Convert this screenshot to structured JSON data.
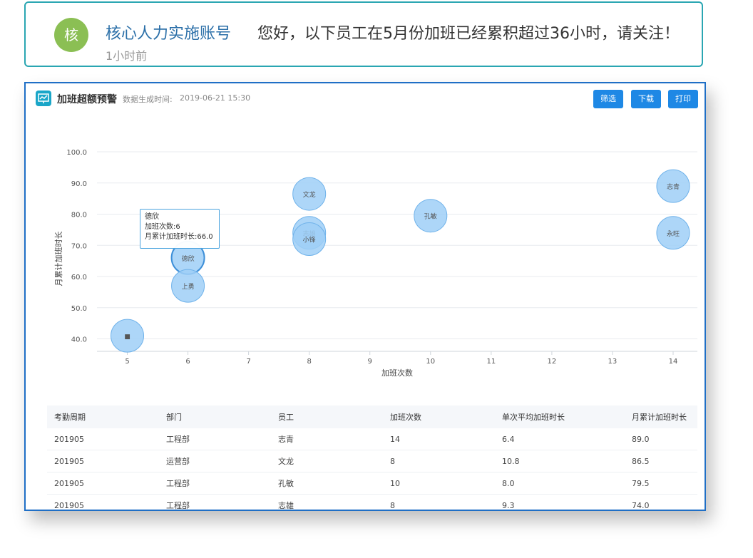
{
  "notification": {
    "avatar_text": "核",
    "sender": "核心人力实施账号",
    "message": "您好，以下员工在5月份加班已经累积超过36小时，请关注！",
    "time": "1小时前"
  },
  "panel": {
    "title": "加班超额预警",
    "meta_label": "数据生成时间:",
    "meta_value": "2019-06-21 15:30",
    "buttons": {
      "filter": "筛选",
      "download": "下载",
      "print": "打印"
    }
  },
  "chart_data": {
    "type": "scatter",
    "xlabel": "加班次数",
    "ylabel": "月累计加班时长",
    "xticks": [
      5,
      6,
      7,
      8,
      9,
      10,
      11,
      12,
      13,
      14
    ],
    "yticks": [
      "40.0",
      "50.0",
      "60.0",
      "70.0",
      "80.0",
      "90.0",
      "100.0"
    ],
    "xlim": [
      4.5,
      14.4
    ],
    "ylim": [
      36,
      100
    ],
    "grid": true,
    "points": [
      {
        "x": 5,
        "y": 41.0,
        "label": "■"
      },
      {
        "x": 6,
        "y": 66.0,
        "label": "德欣"
      },
      {
        "x": 6,
        "y": 57.0,
        "label": "上勇"
      },
      {
        "x": 8,
        "y": 86.5,
        "label": "文龙"
      },
      {
        "x": 8,
        "y": 74.0,
        "label": "志雄"
      },
      {
        "x": 8,
        "y": 72.0,
        "label": "小锋"
      },
      {
        "x": 10,
        "y": 79.5,
        "label": "孔敏"
      },
      {
        "x": 14,
        "y": 89.0,
        "label": "志青"
      },
      {
        "x": 14,
        "y": 74.0,
        "label": "永旺"
      }
    ],
    "tooltip": {
      "name": "德欣",
      "count_line": "加班次数:6",
      "hours_line": "月累计加班时长:66.0"
    },
    "colors": {
      "bubble_fill": "#9fcff7",
      "bubble_stroke": "#6fb2ea",
      "highlight_stroke": "#3d8fd8"
    }
  },
  "table": {
    "headers": [
      "考勤周期",
      "部门",
      "员工",
      "加班次数",
      "单次平均加班时长",
      "月累计加班时长"
    ],
    "rows": [
      [
        "201905",
        "工程部",
        "志青",
        "14",
        "6.4",
        "89.0"
      ],
      [
        "201905",
        "运营部",
        "文龙",
        "8",
        "10.8",
        "86.5"
      ],
      [
        "201905",
        "工程部",
        "孔敏",
        "10",
        "8.0",
        "79.5"
      ],
      [
        "201905",
        "工程部",
        "志雄",
        "8",
        "9.3",
        "74.0"
      ]
    ]
  }
}
